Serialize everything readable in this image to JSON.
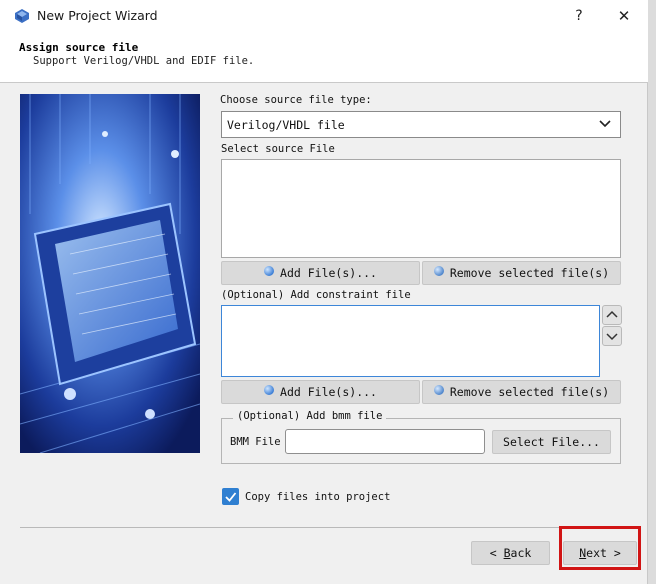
{
  "window": {
    "title": "New Project Wizard",
    "help": "?",
    "close": "✕"
  },
  "header": {
    "title": "Assign source file",
    "subtitle": "Support Verilog/VHDL and EDIF file."
  },
  "source": {
    "type_label": "Choose source file type:",
    "type_value": "Verilog/VHDL file",
    "file_label": "Select source File",
    "add_button": "Add File(s)...",
    "remove_button": "Remove selected file(s)"
  },
  "constraint": {
    "label": "(Optional) Add constraint file",
    "add_button": "Add File(s)...",
    "remove_button": "Remove selected file(s)"
  },
  "bmm": {
    "group_title": "(Optional) Add bmm file",
    "field_label": "BMM File",
    "value": "",
    "select_button": "Select File..."
  },
  "copy": {
    "label": "Copy files into project",
    "checked": true
  },
  "nav": {
    "back_arrow": "<",
    "back_key": "B",
    "back_rest": "ack",
    "next_key": "N",
    "next_rest": "ext",
    "next_arrow": ">"
  },
  "colors": {
    "accent": "#2f7fd1",
    "highlight": "#d11414"
  }
}
